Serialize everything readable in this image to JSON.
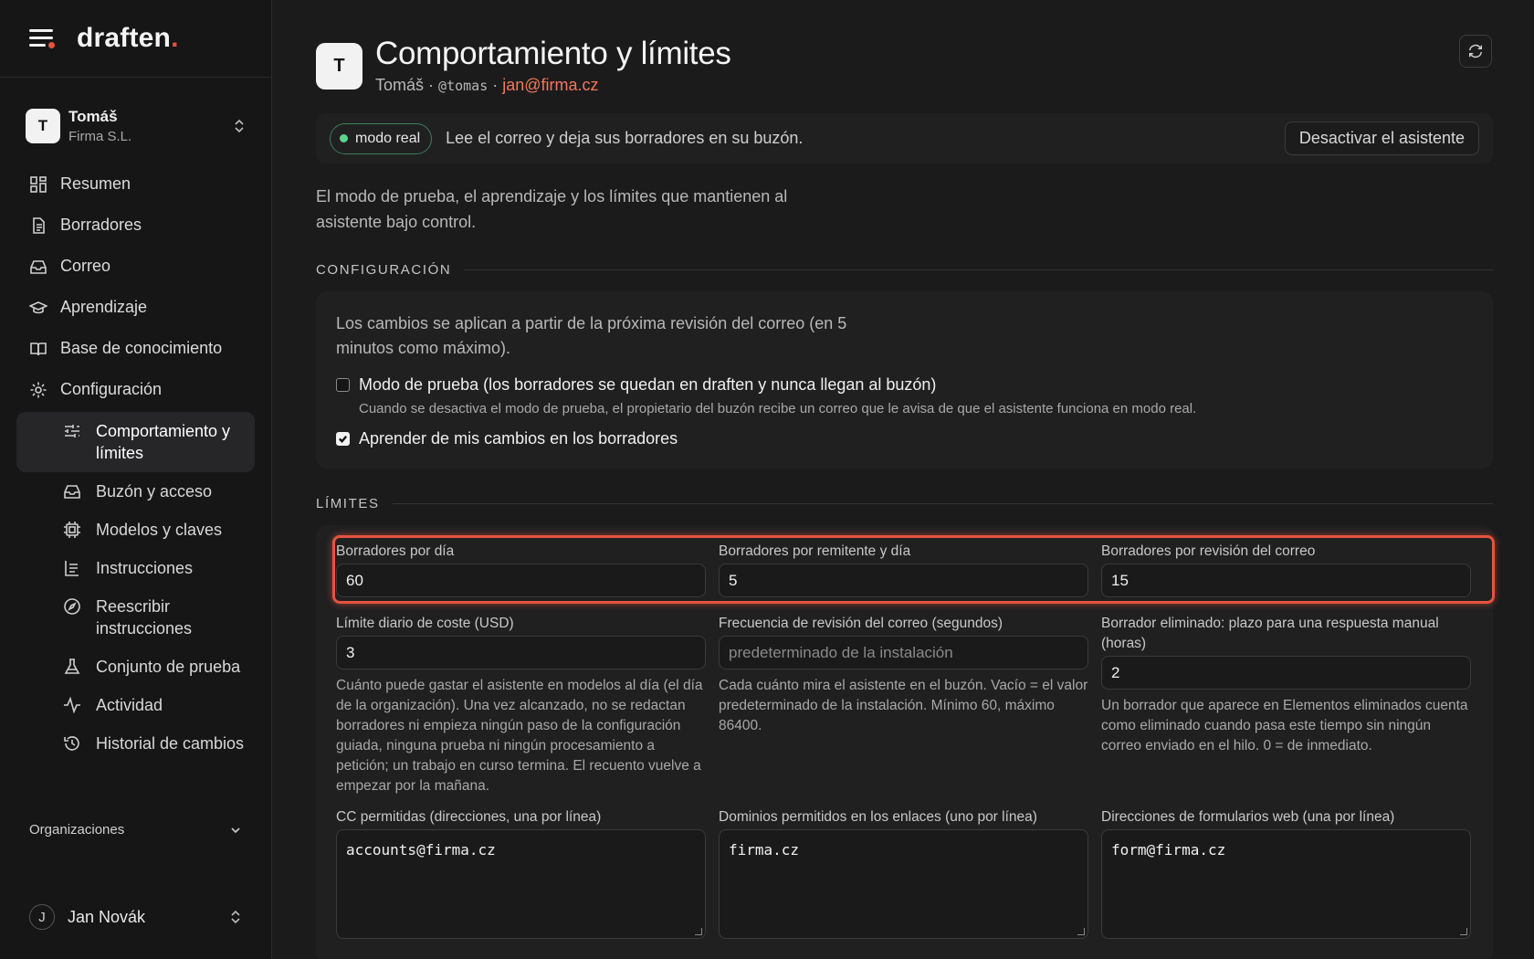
{
  "brand": {
    "name": "draften",
    "accent": "#e5533f"
  },
  "org_switch": {
    "initial": "T",
    "name": "Tomáš",
    "sub": "Firma S.L."
  },
  "nav": {
    "items": [
      {
        "label": "Resumen",
        "icon": "grid-icon"
      },
      {
        "label": "Borradores",
        "icon": "document-icon"
      },
      {
        "label": "Correo",
        "icon": "inbox-icon"
      },
      {
        "label": "Aprendizaje",
        "icon": "graduation-cap-icon"
      },
      {
        "label": "Base de conocimiento",
        "icon": "book-icon"
      },
      {
        "label": "Configuración",
        "icon": "gear-icon"
      }
    ],
    "sub_items": [
      {
        "label": "Comportamiento y límites",
        "icon": "sliders-icon",
        "active": true
      },
      {
        "label": "Buzón y acceso",
        "icon": "inbox-icon"
      },
      {
        "label": "Modelos y claves",
        "icon": "chip-icon"
      },
      {
        "label": "Instrucciones",
        "icon": "list-icon"
      },
      {
        "label": "Reescribir instrucciones",
        "icon": "compass-icon"
      },
      {
        "label": "Conjunto de prueba",
        "icon": "flask-icon"
      },
      {
        "label": "Actividad",
        "icon": "activity-icon"
      },
      {
        "label": "Historial de cambios",
        "icon": "history-icon"
      }
    ]
  },
  "organizations_label": "Organizaciones",
  "user": {
    "initial": "J",
    "name": "Jan Novák"
  },
  "header": {
    "initial": "T",
    "title": "Comportamiento y límites",
    "name": "Tomáš",
    "sep": "·",
    "handle": "@tomas",
    "email": "jan@firma.cz"
  },
  "status": {
    "pill": "modo real",
    "text": "Lee el correo y deja sus borradores en su buzón.",
    "button": "Desactivar el asistente"
  },
  "intro": "El modo de prueba, el aprendizaje y los límites que mantienen al asistente bajo control.",
  "config": {
    "heading": "CONFIGURACIÓN",
    "note": "Los cambios se aplican a partir de la próxima revisión del correo (en 5 minutos como máximo).",
    "test_mode": {
      "label": "Modo de prueba (los borradores se quedan en draften y nunca llegan al buzón)",
      "help": "Cuando se desactiva el modo de prueba, el propietario del buzón recibe un correo que le avisa de que el asistente funciona en modo real.",
      "checked": false
    },
    "learn": {
      "label": "Aprender de mis cambios en los borradores",
      "checked": true
    }
  },
  "limits": {
    "heading": "LÍMITES",
    "drafts_per_day": {
      "label": "Borradores por día",
      "value": "60"
    },
    "drafts_per_sender": {
      "label": "Borradores por remitente y día",
      "value": "5"
    },
    "drafts_per_check": {
      "label": "Borradores por revisión del correo",
      "value": "15"
    },
    "daily_cost": {
      "label": "Límite diario de coste (USD)",
      "value": "3",
      "help": "Cuánto puede gastar el asistente en modelos al día (el día de la organización). Una vez alcanzado, no se redactan borradores ni empieza ningún paso de la configuración guiada, ninguna prueba ni ningún procesamiento a petición; un trabajo en curso termina. El recuento vuelve a empezar por la mañana."
    },
    "check_frequency": {
      "label": "Frecuencia de revisión del correo (segundos)",
      "placeholder": "predeterminado de la instalación",
      "help": "Cada cuánto mira el asistente en el buzón. Vacío = el valor predeterminado de la instalación. Mínimo 60, máximo 86400."
    },
    "deleted_window": {
      "label": "Borrador eliminado: plazo para una respuesta manual (horas)",
      "value": "2",
      "help": "Un borrador que aparece en Elementos eliminados cuenta como eliminado cuando pasa este tiempo sin ningún correo enviado en el hilo. 0 = de inmediato."
    },
    "cc_allowed": {
      "label": "CC permitidas (direcciones, una por línea)",
      "value": "accounts@firma.cz"
    },
    "link_domains": {
      "label": "Dominios permitidos en los enlaces (uno por línea)",
      "value": "firma.cz"
    },
    "form_addresses": {
      "label": "Direcciones de formularios web (una por línea)",
      "value": "form@firma.cz"
    }
  }
}
